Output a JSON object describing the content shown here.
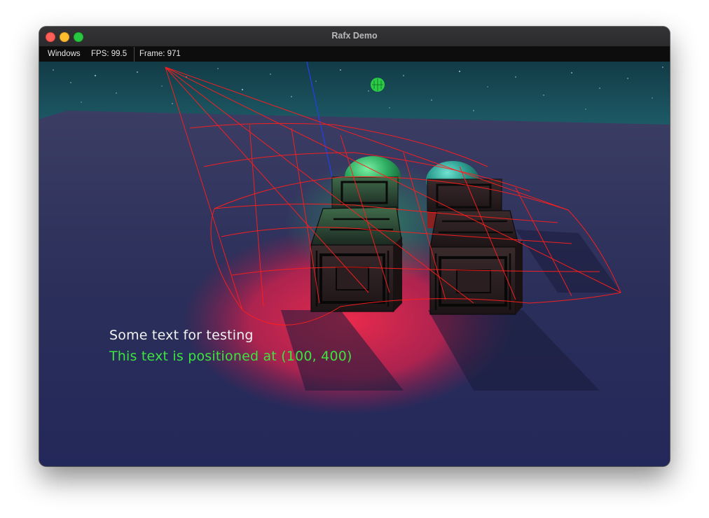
{
  "window": {
    "title": "Rafx Demo"
  },
  "menubar": {
    "windows_label": "Windows",
    "fps": "FPS: 99.5",
    "frame": "Frame: 971"
  },
  "scene": {
    "text_white": "Some text for testing",
    "text_green": "This text is positioned at (100, 400)",
    "colors": {
      "ground": "#2a2f5c",
      "spotlight": "#e0204a",
      "wireframe": "#ff2020",
      "green_text": "#3ee43e",
      "sphere": "#2fae62"
    }
  }
}
